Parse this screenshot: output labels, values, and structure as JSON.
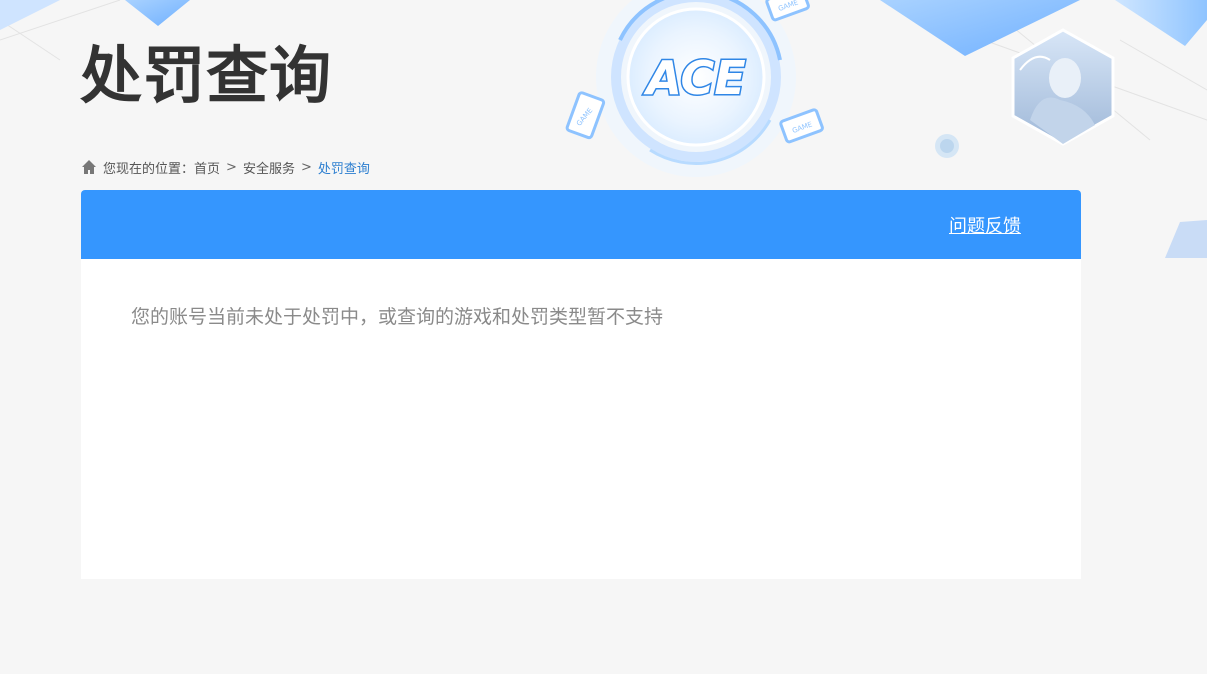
{
  "header": {
    "title": "处罚查询",
    "logo_text": "ACE",
    "game_tag": "GAME"
  },
  "breadcrumb": {
    "prefix": "您现在的位置：",
    "items": [
      "首页",
      "安全服务",
      "处罚查询"
    ],
    "separator": ">"
  },
  "panel": {
    "feedback_label": "问题反馈",
    "message": "您的账号当前未处于处罚中，或查询的游戏和处罚类型暂不支持"
  },
  "colors": {
    "accent": "#3596fe",
    "background": "#f6f6f6",
    "title": "#333333",
    "breadcrumb_current": "#2d7fd0",
    "message": "#8a8a8a"
  },
  "icons": [
    "home-icon",
    "ace-logo",
    "game-device-icon",
    "character-avatar"
  ]
}
